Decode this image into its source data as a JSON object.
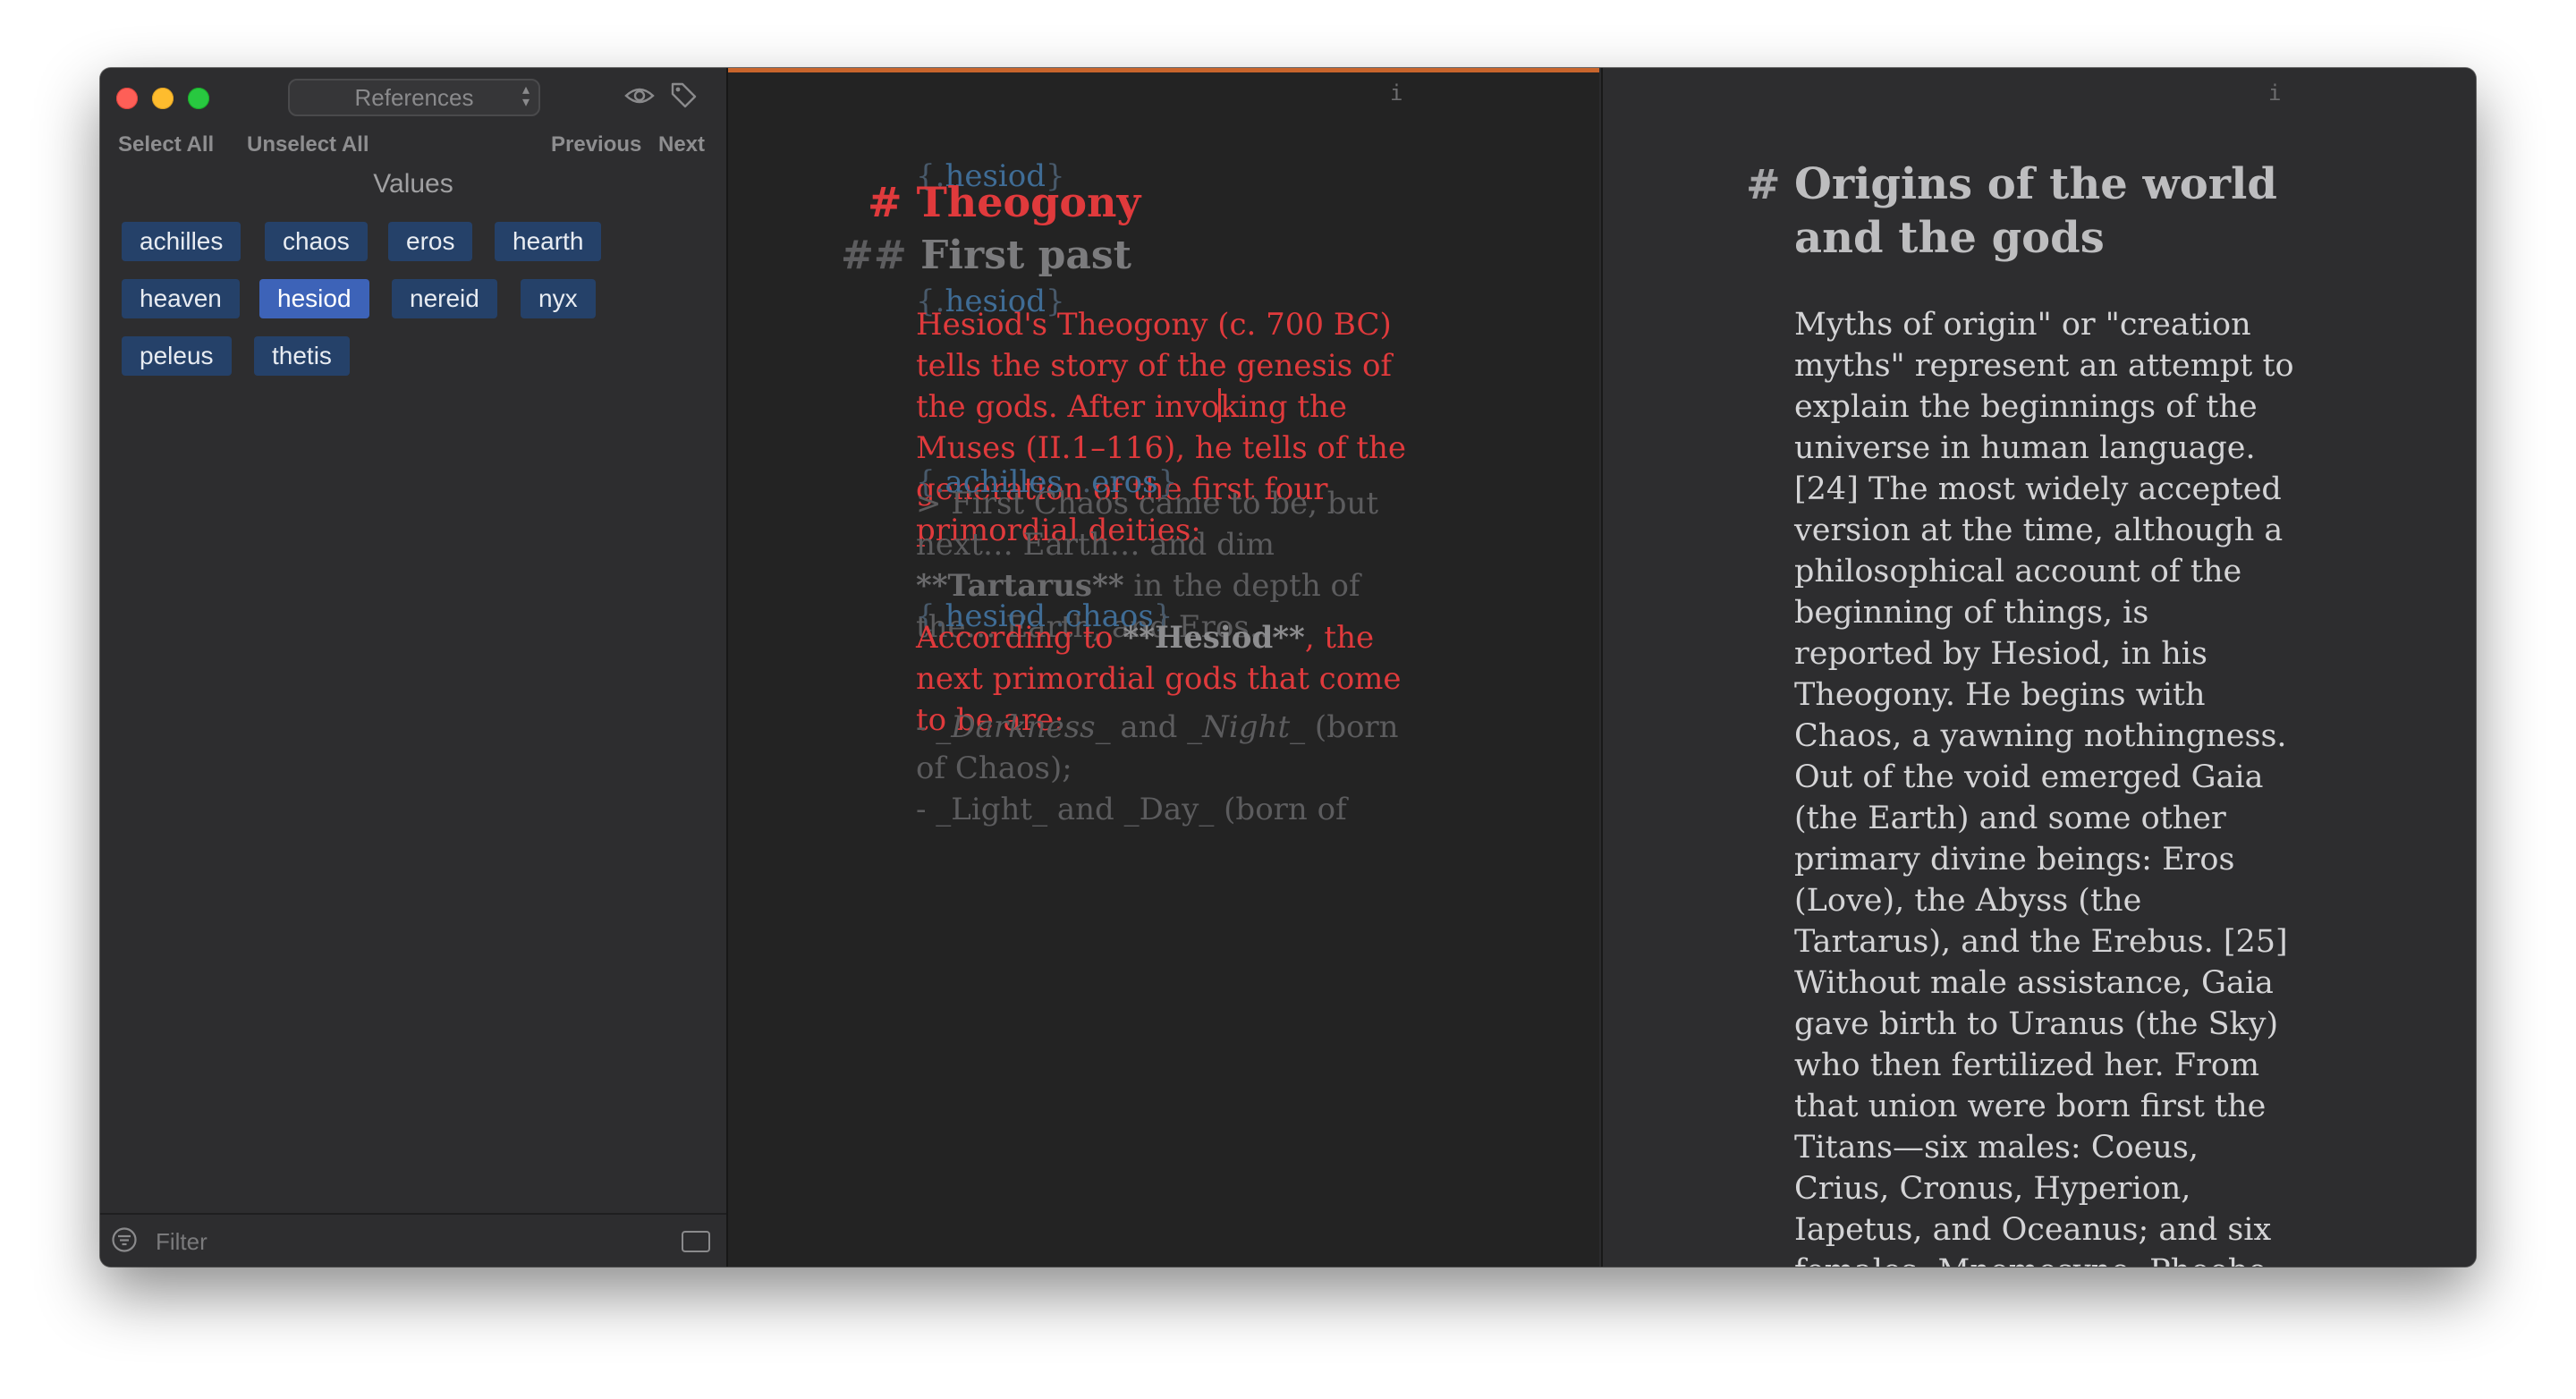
{
  "sidebar": {
    "reference_selector": "References",
    "select_all": "Select All",
    "unselect_all": "Unselect All",
    "previous": "Previous",
    "next": "Next",
    "values_heading": "Values",
    "chips": [
      {
        "label": "achilles",
        "selected": false
      },
      {
        "label": "chaos",
        "selected": false
      },
      {
        "label": "eros",
        "selected": false
      },
      {
        "label": "hearth",
        "selected": false
      },
      {
        "label": "heaven",
        "selected": false
      },
      {
        "label": "hesiod",
        "selected": true
      },
      {
        "label": "nereid",
        "selected": false
      },
      {
        "label": "nyx",
        "selected": false
      },
      {
        "label": "peleus",
        "selected": false
      },
      {
        "label": "thetis",
        "selected": false
      }
    ],
    "filter_placeholder": "Filter"
  },
  "editor": {
    "info_label": "i",
    "tag1_open": "{.",
    "tag1_name": "hesiod",
    "tag1_close": "}",
    "h1_marker": "#",
    "h1_text": "Theogony",
    "h2_marker": "##",
    "h2_text": "First past",
    "tag2_open": "{.",
    "tag2_name": "hesiod",
    "tag2_close": "}",
    "para1_before_cursor": "Hesiod's Theogony (c. 700 BC) tells the story of the genesis of the gods. After invo",
    "para1_after_cursor": "king the Muses (II.1–116), he tells of the generation of the first four primordial deities:",
    "tag3_open": "{.",
    "tag3_name1": "achilles",
    "tag3_sep": "  .",
    "tag3_name2": "eros",
    "tag3_close": "}",
    "quote_a": "> First Chaos came to be, but next… Earth… and dim ",
    "quote_bold": "**Tartarus**",
    "quote_b": " in the depth of the… Earth, and Eros…",
    "tag4_open": "{.",
    "tag4_name1": "hesiod",
    "tag4_sep": " .",
    "tag4_name2": "chaos",
    "tag4_close": "}",
    "para2_a": "According to ",
    "para2_bold": "**Hesiod**",
    "para2_b": ", the next primordial gods that come to be are:",
    "list_dash": "- ",
    "list_em1": "_Darkness_",
    "list_and": " and ",
    "list_em2": "_Night_",
    "list_rest": " (born of Chaos);",
    "list2_partial": "- _Light_ and _Day_ (born of"
  },
  "preview": {
    "info_label": "i",
    "hash": "#",
    "title": "Origins of the world and the gods",
    "body": "Myths of origin\" or \"creation myths\" represent an attempt to explain the beginnings of the universe in human language. [24] The most widely accepted version at the time, although a philosophical account of the beginning of things, is reported by Hesiod, in his Theogony. He begins with Chaos, a yawning nothingness. Out of the void emerged Gaia (the Earth) and some other primary divine beings: Eros (Love), the Abyss (the Tartarus), and the Erebus. [25] Without male assistance, Gaia gave birth to Uranus (the Sky) who then fertilized her. From that union were born first the Titans—six males: Coeus, Crius, Cronus, Hyperion, Iapetus, and Oceanus; and six females: Mnemosyne, Phoebe, Rhea, Theia, Themis, and"
  },
  "colors": {
    "accent_orange": "#c8652c",
    "heading_red": "#e03a3c",
    "chip_blue": "#254169",
    "chip_selected": "#3d63b8",
    "tag_blue": "#3f6c95"
  }
}
